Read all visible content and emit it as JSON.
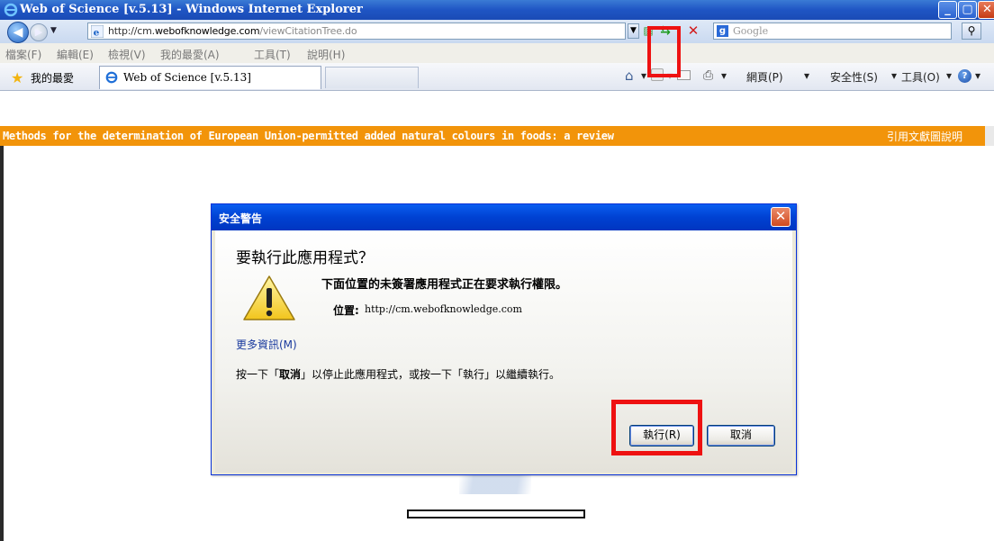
{
  "window": {
    "title": "Web of Science [v.5.13] - Windows Internet Explorer",
    "min_glyph": "_",
    "max_glyph": "▢",
    "close_glyph": "✕"
  },
  "address": {
    "url_prefix": "http://cm.",
    "url_domain": "webofknowledge.com",
    "url_path": "/viewCitationTree.do",
    "search_placeholder": "Google"
  },
  "menu": [
    "檔案(F)",
    "編輯(E)",
    "檢視(V)",
    "我的最愛(A)",
    "工具(T)",
    "說明(H)"
  ],
  "favorites": {
    "label": "我的最愛",
    "tab_title": "Web of Science [v.5.13]"
  },
  "commands": {
    "page": "網頁(P)",
    "safety": "安全性(S)",
    "tools": "工具(O)"
  },
  "page": {
    "header_title": "Methods for the determination of European Union-permitted added natural colours in foods: a review",
    "header_right": "引用文獻圖說明"
  },
  "dialog": {
    "title": "安全警告",
    "heading": "要執行此應用程式？",
    "message": "下面位置的未簽署應用程式正在要求執行權限。",
    "location_label": "位置:",
    "location_value": "http://cm.webofknowledge.com",
    "more_info": "更多資訊(M)",
    "hint_pre": "按一下「",
    "hint_cancel": "取消",
    "hint_mid": "」以停止此應用程式，或按一下「執行」以繼續執行。",
    "run_label": "執行(R)",
    "cancel_label": "取消"
  },
  "colors": {
    "accent_orange": "#f2940a",
    "title_blue": "#0a5ef0",
    "highlight_red": "#ee1111"
  },
  "icons": [
    "ie-icon",
    "back-icon",
    "forward-icon",
    "refresh-icon",
    "stop-icon",
    "search-icon",
    "star-icon",
    "home-icon",
    "rss-icon",
    "mail-icon",
    "print-icon",
    "help-icon",
    "warning-icon",
    "close-icon"
  ]
}
